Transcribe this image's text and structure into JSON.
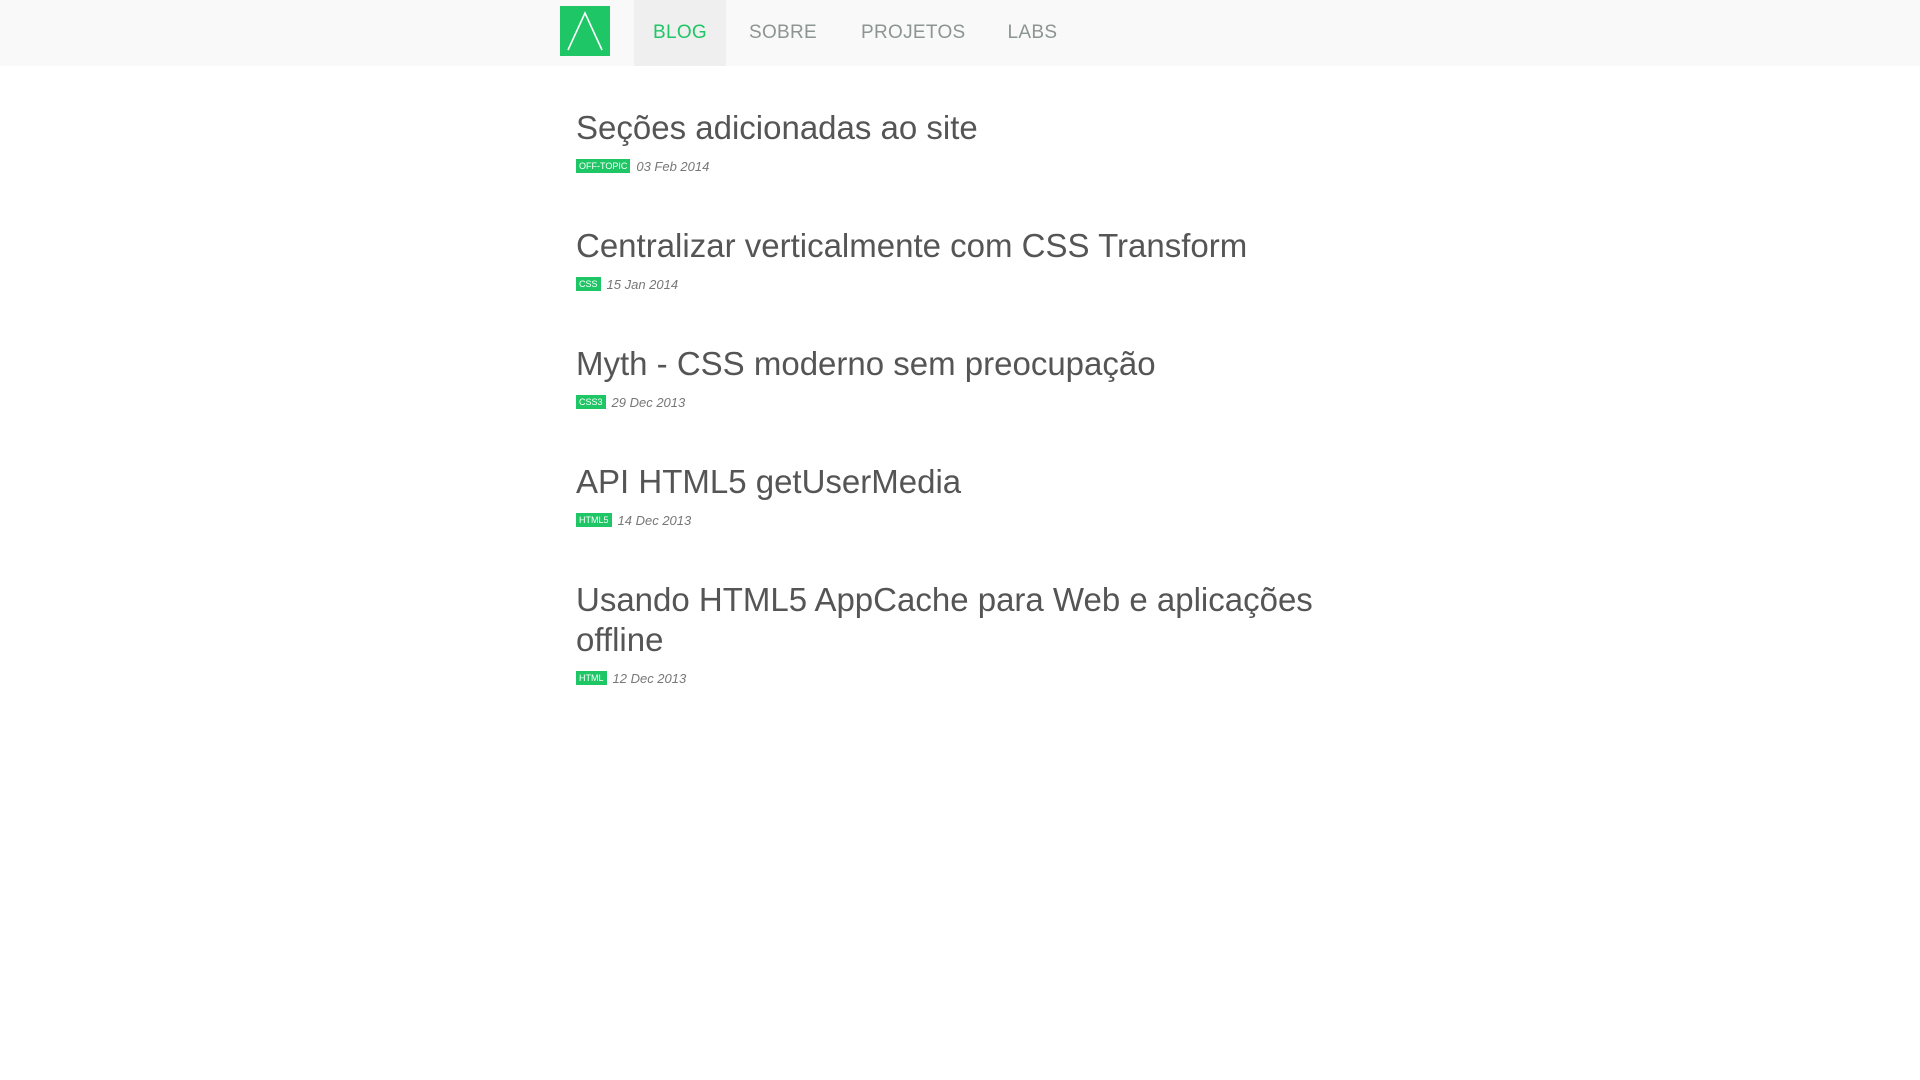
{
  "nav": {
    "items": [
      {
        "label": "BLOG"
      },
      {
        "label": "SOBRE"
      },
      {
        "label": "PROJETOS"
      },
      {
        "label": "LABS"
      }
    ]
  },
  "posts": [
    {
      "title": "Seções adicionadas ao site",
      "tag": "OFF-TOPIC",
      "date": "03 Feb 2014"
    },
    {
      "title": "Centralizar verticalmente com CSS Transform",
      "tag": "CSS",
      "date": "15 Jan 2014"
    },
    {
      "title": "Myth - CSS moderno sem preocupação",
      "tag": "CSS3",
      "date": "29 Dec 2013"
    },
    {
      "title": "API HTML5 getUserMedia",
      "tag": "HTML5",
      "date": "14 Dec 2013"
    },
    {
      "title": "Usando HTML5 AppCache para Web e aplicações offline",
      "tag": "HTML",
      "date": "12 Dec 2013"
    }
  ],
  "colors": {
    "accent": "#1ec665",
    "nav_text": "#8c9591",
    "title_text": "#555555"
  },
  "icons": {
    "logo": "logo-icon"
  }
}
